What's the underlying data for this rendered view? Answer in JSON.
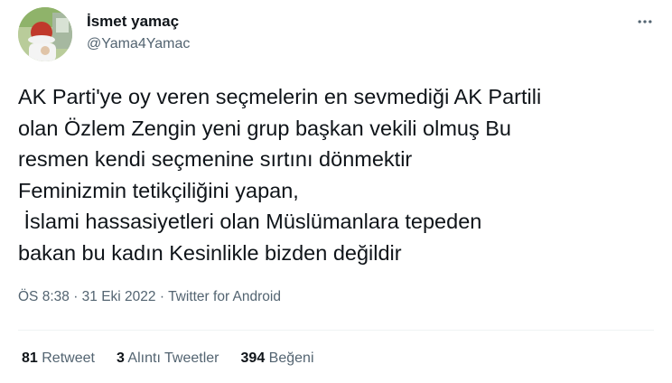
{
  "user": {
    "name": "İsmet yamaç",
    "handle": "@Yama4Yamac"
  },
  "tweet": {
    "lines": [
      "AK Parti'ye oy veren seçmelerin en sevmediği AK Partili",
      "olan Özlem Zengin yeni grup başkan vekili olmuş Bu",
      "resmen kendi seçmenine sırtını dönmektir",
      "Feminizmin tetikçiliğini yapan,",
      " İslami hassasiyetleri olan Müslümanlara tepeden",
      "bakan bu kadın Kesinlikle bizden değildir"
    ],
    "time": "ÖS 8:38",
    "date": "31 Eki 2022",
    "source": "Twitter for Android",
    "separator": "·"
  },
  "stats": {
    "retweets": {
      "count": "81",
      "label": "Retweet"
    },
    "quotes": {
      "count": "3",
      "label": "Alıntı Tweetler"
    },
    "likes": {
      "count": "394",
      "label": "Beğeni"
    }
  },
  "icons": {
    "more": "more-horizontal-icon"
  },
  "colors": {
    "text": "#0f1419",
    "secondary": "#536471",
    "divider": "#eff3f4"
  }
}
